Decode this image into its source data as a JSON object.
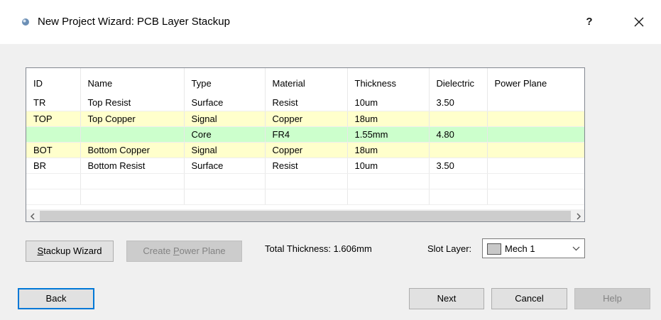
{
  "window": {
    "title": "New Project Wizard: PCB Layer Stackup",
    "help_glyph": "?",
    "close_icon": "close-icon"
  },
  "grid": {
    "columns": [
      "ID",
      "Name",
      "Type",
      "Material",
      "Thickness",
      "Dielectric",
      "Power Plane"
    ],
    "rows": [
      {
        "id": "TR",
        "name": "Top Resist",
        "type": "Surface",
        "material": "Resist",
        "thickness": "10um",
        "dielectric": "3.50",
        "power_plane": "",
        "highlight": "none"
      },
      {
        "id": "TOP",
        "name": "Top Copper",
        "type": "Signal",
        "material": "Copper",
        "thickness": "18um",
        "dielectric": "",
        "power_plane": "",
        "highlight": "#ffffcc"
      },
      {
        "id": "",
        "name": "",
        "type": "Core",
        "material": "FR4",
        "thickness": "1.55mm",
        "dielectric": "4.80",
        "power_plane": "",
        "highlight": "#ccffcc"
      },
      {
        "id": "BOT",
        "name": "Bottom Copper",
        "type": "Signal",
        "material": "Copper",
        "thickness": "18um",
        "dielectric": "",
        "power_plane": "",
        "highlight": "#ffffcc"
      },
      {
        "id": "BR",
        "name": "Bottom Resist",
        "type": "Surface",
        "material": "Resist",
        "thickness": "10um",
        "dielectric": "3.50",
        "power_plane": "",
        "highlight": "none"
      }
    ],
    "scroll_left_glyph": "<",
    "scroll_right_glyph": ">"
  },
  "actions": {
    "stackup_wizard_pre": "S",
    "stackup_wizard_post": "tackup Wizard",
    "create_power_plane_pre": "Create ",
    "create_power_plane_u": "P",
    "create_power_plane_post": "ower Plane",
    "total_thickness_label": "Total Thickness: 1.606mm",
    "slot_layer_label": "Slot Layer:",
    "slot_layer_value": "Mech 1"
  },
  "footer": {
    "back": "Back",
    "next": "Next",
    "cancel": "Cancel",
    "help": "Help"
  },
  "colors": {
    "copper_row": "#ffffcc",
    "core_row": "#ccffcc",
    "focus_border": "#0078d7"
  }
}
